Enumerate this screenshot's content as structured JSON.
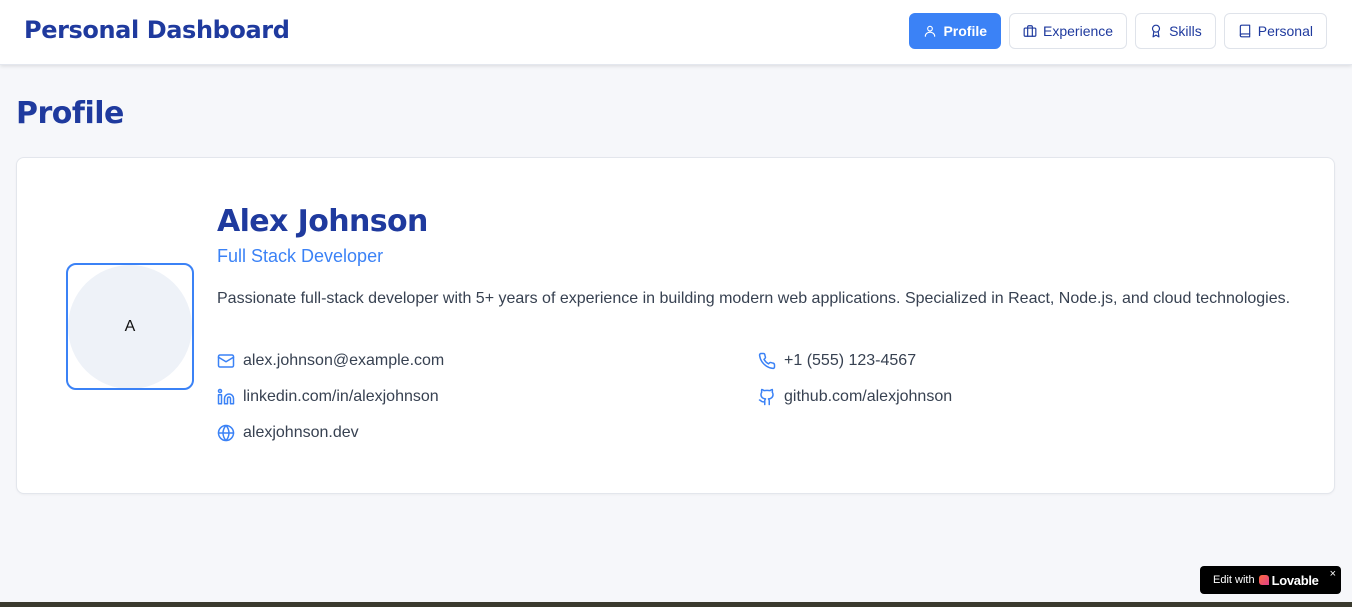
{
  "header": {
    "brand": "Personal Dashboard",
    "nav": [
      {
        "label": "Profile",
        "icon": "user-icon",
        "active": true
      },
      {
        "label": "Experience",
        "icon": "briefcase-icon",
        "active": false
      },
      {
        "label": "Skills",
        "icon": "award-icon",
        "active": false
      },
      {
        "label": "Personal",
        "icon": "book-icon",
        "active": false
      }
    ]
  },
  "page": {
    "title": "Profile"
  },
  "profile": {
    "avatar_initial": "A",
    "name": "Alex Johnson",
    "role": "Full Stack Developer",
    "bio": "Passionate full-stack developer with 5+ years of experience in building modern web applications. Specialized in React, Node.js, and cloud technologies.",
    "email": "alex.johnson@example.com",
    "phone": "+1 (555) 123-4567",
    "linkedin": "linkedin.com/in/alexjohnson",
    "github": "github.com/alexjohnson",
    "website": "alexjohnson.dev"
  },
  "badge": {
    "prefix": "Edit with",
    "brand": "Lovable",
    "close": "×"
  },
  "colors": {
    "accent": "#3b82f6",
    "brand": "#1f3a9e",
    "background": "#f6f7fa"
  }
}
